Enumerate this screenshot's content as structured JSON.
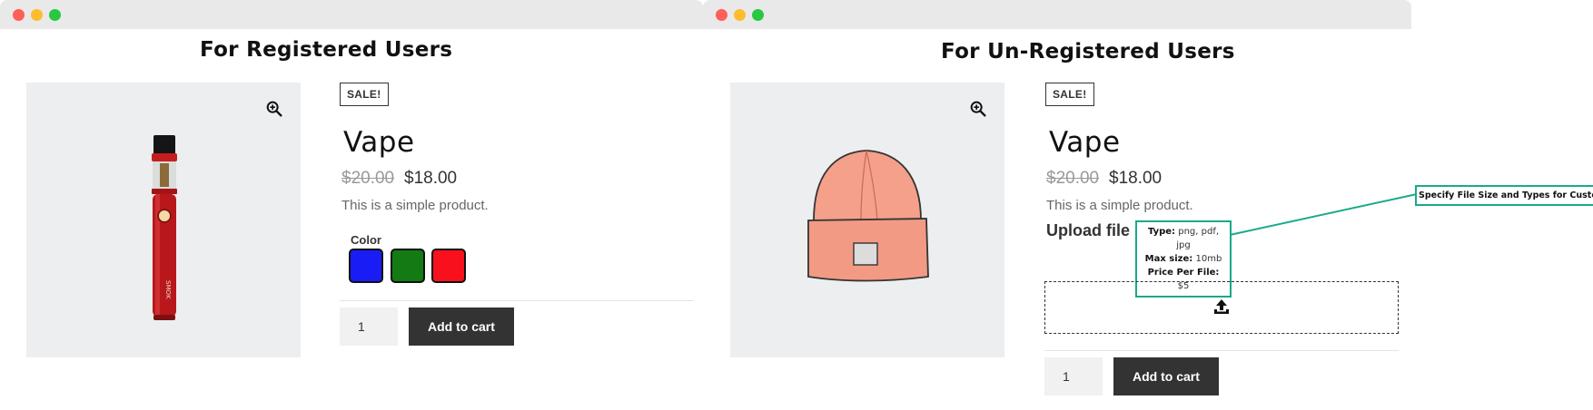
{
  "left": {
    "heading": "For Registered Users",
    "sale_badge": "SALE!",
    "product_title": "Vape",
    "old_price": "$20.00",
    "new_price": "$18.00",
    "description": "This is a simple product.",
    "color_label": "Color",
    "swatches": [
      "#1a1cf5",
      "#137a14",
      "#f8111d"
    ],
    "quantity": "1",
    "add_to_cart": "Add to cart",
    "brand_text": "SMOK"
  },
  "right": {
    "heading": "For Un-Registered Users",
    "sale_badge": "SALE!",
    "product_title": "Vape",
    "old_price": "$20.00",
    "new_price": "$18.00",
    "description": "This is a simple product.",
    "upload_label": "Upload file",
    "info": {
      "type_label": "Type:",
      "type_value": "png, pdf, jpg",
      "size_label": "Max size:",
      "size_value": "10mb",
      "price_label": "Price Per File:",
      "price_value": "$5"
    },
    "quantity": "1",
    "add_to_cart": "Add to cart"
  },
  "callout": "Specify File Size and Types for Customers",
  "colors": {
    "accent": "#1aa989",
    "button": "#333333",
    "image_bg": "#eceef0"
  }
}
